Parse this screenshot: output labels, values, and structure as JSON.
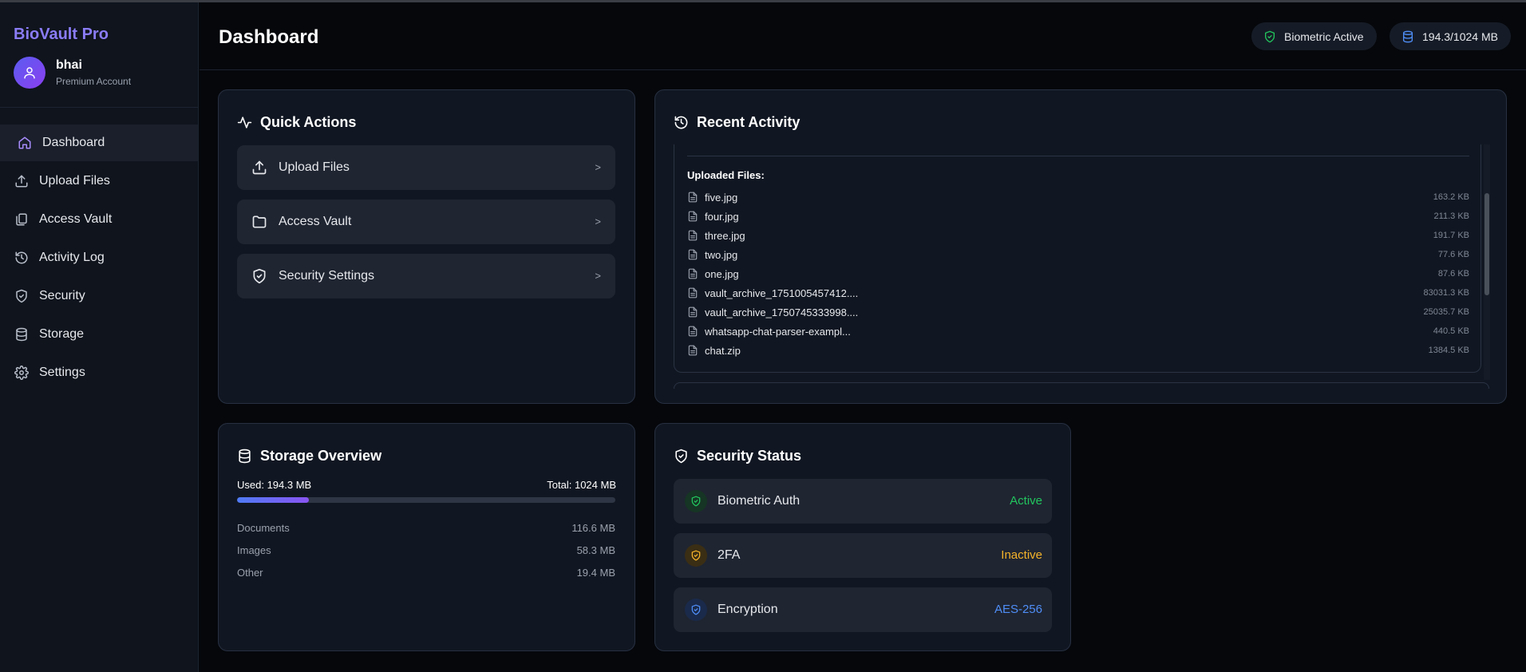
{
  "app": {
    "brand": "BioVault Pro"
  },
  "user": {
    "name": "bhai",
    "plan": "Premium Account"
  },
  "nav": [
    {
      "label": "Dashboard",
      "icon": "home-icon"
    },
    {
      "label": "Upload Files",
      "icon": "upload-icon"
    },
    {
      "label": "Access Vault",
      "icon": "files-icon"
    },
    {
      "label": "Activity Log",
      "icon": "history-icon"
    },
    {
      "label": "Security",
      "icon": "shield-icon"
    },
    {
      "label": "Storage",
      "icon": "database-icon"
    },
    {
      "label": "Settings",
      "icon": "gear-icon"
    }
  ],
  "header": {
    "title": "Dashboard",
    "biometric_pill": "Biometric Active",
    "storage_pill": "194.3/1024 MB"
  },
  "quick_actions": {
    "title": "Quick Actions",
    "buttons": [
      {
        "label": "Upload Files",
        "chevron": ">"
      },
      {
        "label": "Access Vault",
        "chevron": ">"
      },
      {
        "label": "Security Settings",
        "chevron": ">"
      }
    ]
  },
  "recent_activity": {
    "title": "Recent Activity",
    "section_label": "Uploaded Files:",
    "files": [
      {
        "name": "five.jpg",
        "size": "163.2 KB"
      },
      {
        "name": "four.jpg",
        "size": "211.3 KB"
      },
      {
        "name": "three.jpg",
        "size": "191.7 KB"
      },
      {
        "name": "two.jpg",
        "size": "77.6 KB"
      },
      {
        "name": "one.jpg",
        "size": "87.6 KB"
      },
      {
        "name": "vault_archive_1751005457412....",
        "size": "83031.3 KB"
      },
      {
        "name": "vault_archive_1750745333998....",
        "size": "25035.7 KB"
      },
      {
        "name": "whatsapp-chat-parser-exampl...",
        "size": "440.5 KB"
      },
      {
        "name": "chat.zip",
        "size": "1384.5 KB"
      }
    ]
  },
  "storage_overview": {
    "title": "Storage Overview",
    "used_label": "Used: 194.3 MB",
    "total_label": "Total: 1024 MB",
    "used_fraction": 0.19,
    "rows": [
      {
        "label": "Documents",
        "value": "116.6 MB"
      },
      {
        "label": "Images",
        "value": "58.3 MB"
      },
      {
        "label": "Other",
        "value": "19.4 MB"
      }
    ]
  },
  "security_status": {
    "title": "Security Status",
    "rows": [
      {
        "label": "Biometric Auth",
        "value": "Active",
        "color": "#22c55e"
      },
      {
        "label": "2FA",
        "value": "Inactive",
        "color": "#f5b32a"
      },
      {
        "label": "Encryption",
        "value": "AES-256",
        "color": "#4f8ef7"
      }
    ]
  }
}
